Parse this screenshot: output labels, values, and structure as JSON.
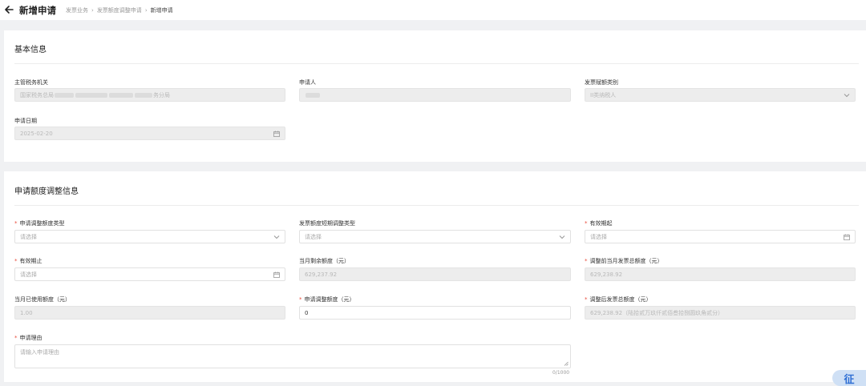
{
  "header": {
    "title": "新增申请",
    "breadcrumb": [
      "发票业务",
      "发票额度调整申请",
      "新增申请"
    ]
  },
  "basic_info": {
    "section_title": "基本信息",
    "tax_authority": {
      "label": "主管税务机关",
      "value_start": "国家税务总局",
      "value_end": "务分局"
    },
    "applicant": {
      "label": "申请人",
      "value": ""
    },
    "taxpayer_type": {
      "label": "发票赋额类别",
      "value": "II类纳税人"
    },
    "apply_date": {
      "label": "申请日期",
      "value": "2025-02-20"
    }
  },
  "adjust_info": {
    "section_title": "申请额度调整信息",
    "adjust_type": {
      "label": "申请调整额度类型",
      "placeholder": "请选择",
      "required": true
    },
    "short_term_type": {
      "label": "发票额度短期调整类型",
      "placeholder": "请选择",
      "required": false
    },
    "valid_from": {
      "label": "有效期起",
      "placeholder": "请选择",
      "required": true
    },
    "valid_to": {
      "label": "有效期止",
      "placeholder": "请选择",
      "required": true
    },
    "month_remaining": {
      "label": "当月剩余额度（元）",
      "value": "629,237.92"
    },
    "before_total": {
      "label": "调整前当月发票总额度（元）",
      "value": "629,238.92",
      "required": true
    },
    "month_used": {
      "label": "当月已使用额度（元）",
      "value": "1.00"
    },
    "adjust_amount": {
      "label": "申请调整额度（元）",
      "value": "0",
      "required": true
    },
    "after_total": {
      "label": "调整后发票总额度（元）",
      "value": "629,238.92（陆拾贰万玖仟贰佰叁拾捌圆玖角贰分）",
      "required": true
    },
    "reason": {
      "label": "申请理由",
      "placeholder": "请输入申请理由",
      "counter": "0/1000",
      "required": true
    }
  },
  "float_badge": {
    "text": "征"
  },
  "icons": {
    "back": "arrow-left-icon",
    "calendar": "calendar-icon",
    "dropdown": "chevron-down-icon"
  },
  "colors": {
    "required": "#e74c3c",
    "disabled_bg": "#ededed",
    "page_bg": "#f0f1f3"
  }
}
